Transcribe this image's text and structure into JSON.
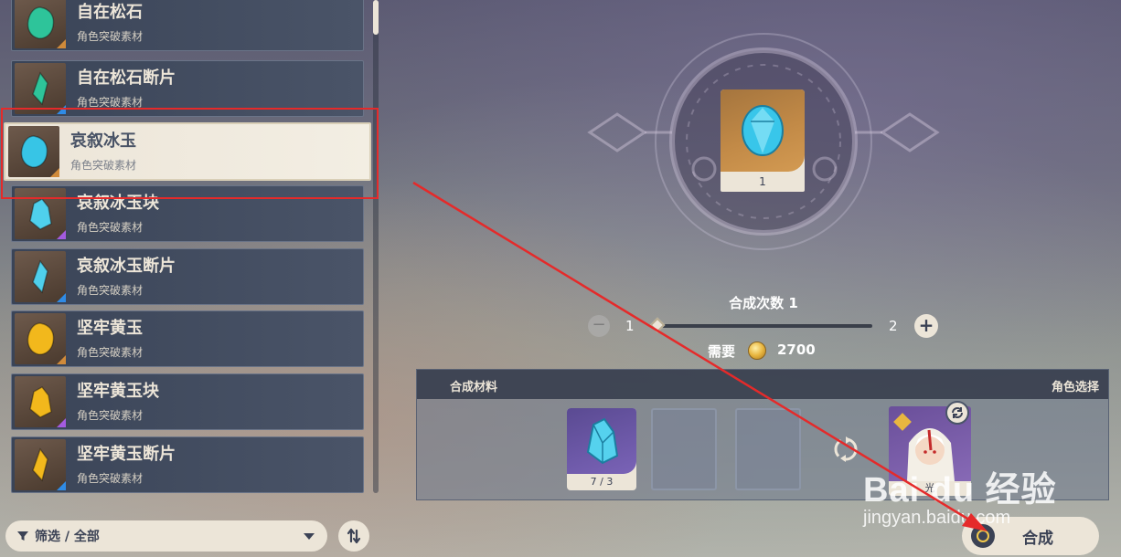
{
  "materials_list": {
    "items": [
      {
        "name": "自在松石",
        "category": "角色突破素材",
        "corner_color": "#d08a3a",
        "gem_color": "#2ec49a",
        "icon": "turquoise-gem-icon"
      },
      {
        "name": "自在松石断片",
        "category": "角色突破素材",
        "corner_color": "#2f8be6",
        "gem_color": "#2ec49a",
        "icon": "turquoise-fragment-icon"
      },
      {
        "name": "哀叙冰玉",
        "category": "角色突破素材",
        "corner_color": "#d08a3a",
        "gem_color": "#37c5e6",
        "icon": "ice-jade-gem-icon",
        "selected": true
      },
      {
        "name": "哀叙冰玉块",
        "category": "角色突破素材",
        "corner_color": "#a45be0",
        "gem_color": "#4fd0ec",
        "icon": "ice-jade-chunk-icon"
      },
      {
        "name": "哀叙冰玉断片",
        "category": "角色突破素材",
        "corner_color": "#2f8be6",
        "gem_color": "#4fd0ec",
        "icon": "ice-jade-fragment-icon"
      },
      {
        "name": "坚牢黄玉",
        "category": "角色突破素材",
        "corner_color": "#d08a3a",
        "gem_color": "#f2b81c",
        "icon": "topaz-gem-icon"
      },
      {
        "name": "坚牢黄玉块",
        "category": "角色突破素材",
        "corner_color": "#a45be0",
        "gem_color": "#f2b81c",
        "icon": "topaz-chunk-icon"
      },
      {
        "name": "坚牢黄玉断片",
        "category": "角色突破素材",
        "corner_color": "#2f8be6",
        "gem_color": "#f2b81c",
        "icon": "topaz-fragment-icon"
      }
    ]
  },
  "filter": {
    "label": "筛选 / 全部",
    "icon": "funnel-icon"
  },
  "sort": {
    "icon": "sort-icon"
  },
  "result": {
    "count": "1",
    "icon": "ice-jade-gem-icon"
  },
  "craft_count": {
    "label": "合成次数 1",
    "min": "1",
    "max": "2",
    "slider_fraction": 0.0,
    "minus": "−",
    "plus": "+"
  },
  "cost": {
    "label": "需要",
    "value": "2700",
    "icon": "mora-coin-icon"
  },
  "materials_panel": {
    "title": "合成材料",
    "character_title": "角色选择",
    "material_count": "7 / 3",
    "character_name": "光",
    "reset_icon": "reset-icon",
    "swap_icon": "swap-icon"
  },
  "craft_button": {
    "label": "合成",
    "icon": "craft-circle-icon"
  },
  "watermark": {
    "logo": "Bai du 经验",
    "url": "jingyan.baidu.com"
  },
  "colors": {
    "annotation": "#e52a2a",
    "panel": "#3a4457",
    "cream": "#ece5d8"
  }
}
